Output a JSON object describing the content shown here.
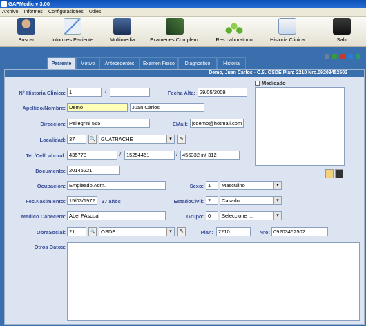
{
  "window": {
    "title": "GAFMedic v 3.00"
  },
  "menu": [
    "Archivo",
    "Informes",
    "Configuraciones",
    "Utiles"
  ],
  "toolbar": {
    "buscar": "Buscar",
    "informes": "Informes Paciente",
    "multimedia": "Multimedia",
    "examenes": "Examenes Complem.",
    "laboratorio": "Res.Laboratorio",
    "historia": "Historia Clinica",
    "salir": "Salir"
  },
  "tabs": [
    "Paciente",
    "Motivo",
    "Antecedentes",
    "Examen Fisico",
    "Diagnostico",
    "Historia"
  ],
  "header": "Demo, Juan Carlos - O.S. OSDE Plan: 2210 Nro.09203452502",
  "labels": {
    "historia": "N° Historia Clinica:",
    "fecha_alta": "Fecha Alta:",
    "medicado": "Medicado",
    "apellido": "Apellido/Nombre:",
    "direccion": "Direccion:",
    "email": "EMail:",
    "localidad": "Localidad:",
    "telefono": "Tel./Cel/Laboral:",
    "documento": "Documento:",
    "ocupacion": "Ocupacion:",
    "sexo": "Sexo:",
    "fec_nac": "Fec.Nacimiento:",
    "estado_civil": "EstadoCivil:",
    "medico": "Medico Cabecera:",
    "grupo": "Grupo:",
    "obra_social": "ObraSocial:",
    "plan": "Plan:",
    "nro": "Nro:",
    "otros": "Otros Datos:"
  },
  "values": {
    "historia1": "1",
    "historia2": "",
    "fecha_alta": "29/05/2009",
    "apellido": "Demo",
    "nombre": "Juan Carlos",
    "direccion": "Pellegrini 565",
    "email": "jcdemo@hotmail.com",
    "localidad_cod": "37",
    "localidad": "GUATRACHE",
    "tel": "435778",
    "cel": "15254451",
    "laboral": "456332 int 312",
    "documento": "20145221",
    "ocupacion": "Empleado Adm.",
    "sexo_cod": "1",
    "sexo": "Masculino",
    "fec_nac": "15/03/1972",
    "edad": "37 años",
    "estado_cod": "2",
    "estado": "Casado",
    "medico": "Abel PAscual",
    "grupo_cod": "0",
    "grupo": "Seleccione ...",
    "os_cod": "21",
    "os": "OSDE",
    "plan": "2210",
    "nro": "09203452502"
  }
}
